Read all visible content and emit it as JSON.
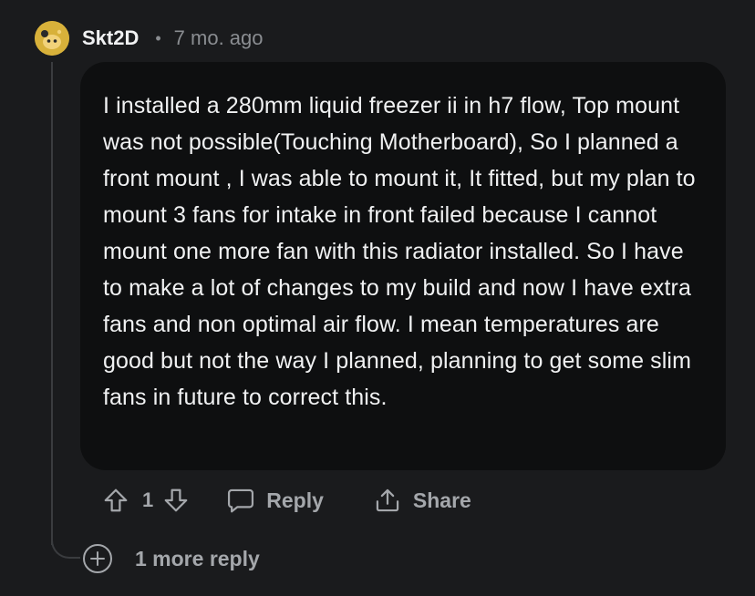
{
  "comment": {
    "author": "Skt2D",
    "separator": "•",
    "timestamp": "7 mo. ago",
    "body": "I installed a 280mm liquid freezer ii in h7 flow, Top mount was not possible(Touching Motherboard), So I planned a front mount , I was able to mount it, It fitted, but my plan to mount 3 fans for intake in front failed because I cannot mount one more fan with this radiator installed. So I have to make a lot of changes to my build and now I have extra fans and non optimal air flow. I mean temperatures are good but not the way I planned, planning to get some slim fans in future to correct this.",
    "avatar_icon": "snoo-avatar-icon",
    "avatar_color": "#d8b13a"
  },
  "actions": {
    "upvote_icon": "upvote-arrow-icon",
    "score": "1",
    "downvote_icon": "downvote-arrow-icon",
    "reply_label": "Reply",
    "reply_icon": "speech-bubble-icon",
    "share_label": "Share",
    "share_icon": "share-upload-icon"
  },
  "more_replies": {
    "label": "1 more reply",
    "icon": "plus-circle-icon"
  },
  "colors": {
    "background": "#1a1b1d",
    "bubble": "#0e0f10",
    "text": "#f0f1f2",
    "muted": "#a4a7ab"
  }
}
